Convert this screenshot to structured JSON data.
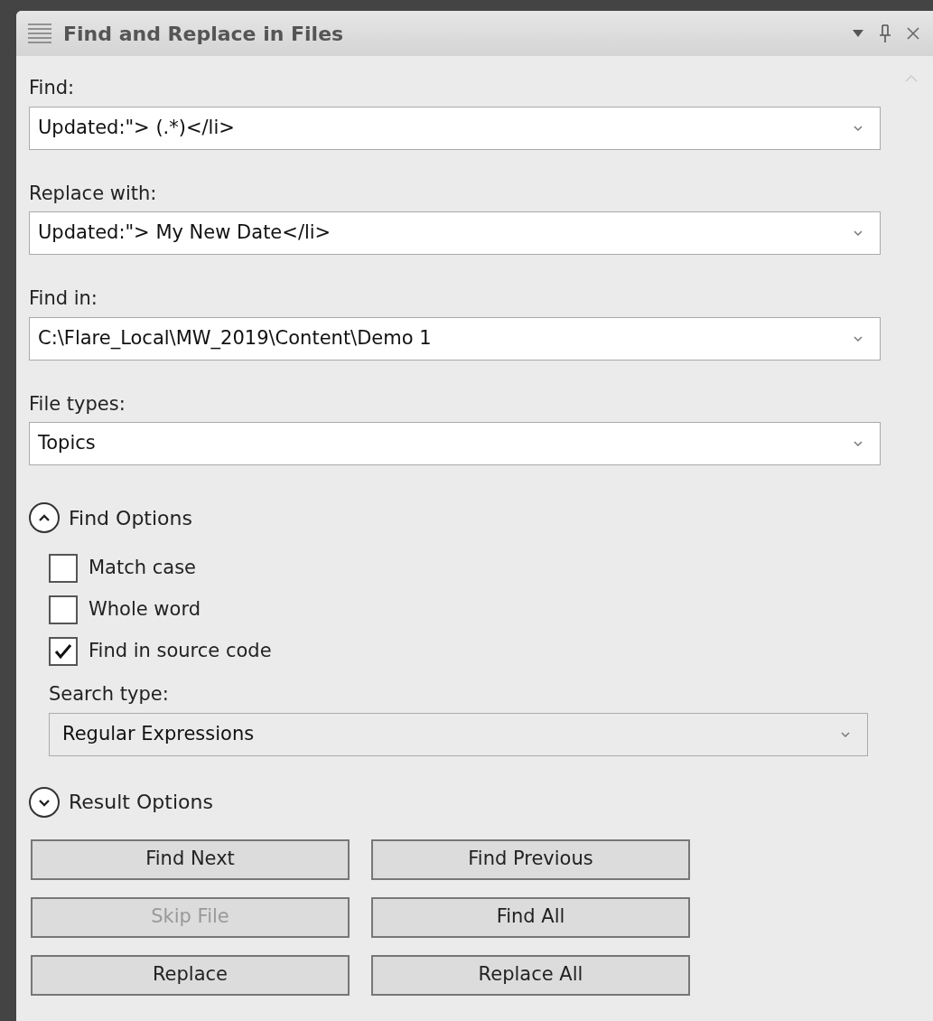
{
  "panel": {
    "title": "Find and Replace in Files"
  },
  "fields": [
    {
      "label": "Find:",
      "value": "Updated:\"> (.*)</li>"
    },
    {
      "label": "Replace with:",
      "value": "Updated:\"> My New Date</li>"
    },
    {
      "label": "Find in:",
      "value": "C:\\Flare_Local\\MW_2019\\Content\\Demo 1"
    },
    {
      "label": "File types:",
      "value": "Topics"
    }
  ],
  "find_options": {
    "label": "Find Options",
    "expanded": true,
    "checkboxes": [
      {
        "label": "Match case",
        "checked": false
      },
      {
        "label": "Whole word",
        "checked": false
      },
      {
        "label": "Find in source code",
        "checked": true
      }
    ],
    "search_type": {
      "label": "Search type:",
      "value": "Regular Expressions"
    }
  },
  "result_options": {
    "label": "Result Options",
    "expanded": false
  },
  "buttons": [
    {
      "label": "Find Next",
      "disabled": false
    },
    {
      "label": "Find Previous",
      "disabled": false
    },
    {
      "label": "Skip File",
      "disabled": true
    },
    {
      "label": "Find All",
      "disabled": false
    },
    {
      "label": "Replace",
      "disabled": false
    },
    {
      "label": "Replace All",
      "disabled": false
    }
  ]
}
